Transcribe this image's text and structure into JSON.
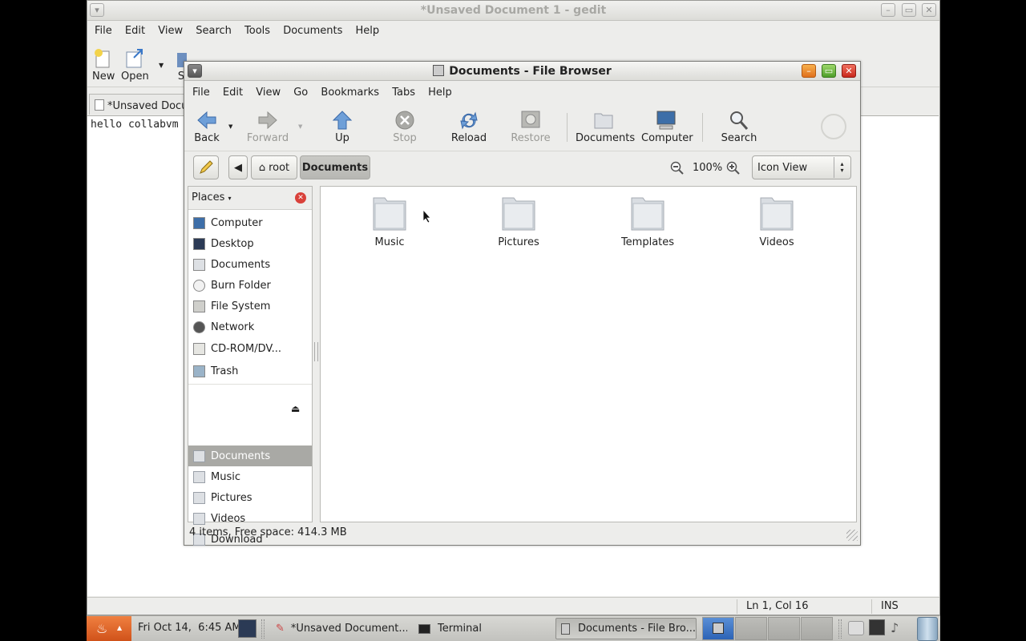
{
  "gedit": {
    "title": "*Unsaved Document 1 - gedit",
    "menu": [
      "File",
      "Edit",
      "View",
      "Search",
      "Tools",
      "Documents",
      "Help"
    ],
    "toolbar": {
      "new": "New",
      "open": "Open",
      "save_partial": "S"
    },
    "tab_label": "*Unsaved Docum",
    "editor_text": "hello collabvm",
    "status": {
      "position": "Ln 1, Col 16",
      "mode": "INS"
    }
  },
  "file_browser": {
    "title": "Documents - File Browser",
    "menu": [
      "File",
      "Edit",
      "View",
      "Go",
      "Bookmarks",
      "Tabs",
      "Help"
    ],
    "toolbar": {
      "back": "Back",
      "forward": "Forward",
      "up": "Up",
      "stop": "Stop",
      "reload": "Reload",
      "restore": "Restore",
      "documents": "Documents",
      "computer": "Computer",
      "search": "Search"
    },
    "path": [
      "root",
      "Documents"
    ],
    "zoom": "100%",
    "view_mode": "Icon View",
    "sidebar": {
      "header": "Places",
      "places": [
        {
          "label": "Computer",
          "icon": "computer-icon"
        },
        {
          "label": "Desktop",
          "icon": "desktop-icon"
        },
        {
          "label": "Documents",
          "icon": "folder-icon"
        },
        {
          "label": "Burn Folder",
          "icon": "disc-icon"
        },
        {
          "label": "File System",
          "icon": "drive-icon"
        },
        {
          "label": "Network",
          "icon": "network-icon"
        },
        {
          "label": "CD-ROM/DV...",
          "icon": "cdrom-icon"
        },
        {
          "label": "Trash",
          "icon": "trash-icon"
        }
      ],
      "bookmarks": [
        {
          "label": "Documents",
          "selected": true
        },
        {
          "label": "Music"
        },
        {
          "label": "Pictures"
        },
        {
          "label": "Videos"
        },
        {
          "label": "Download"
        }
      ]
    },
    "items": [
      "Music",
      "Pictures",
      "Templates",
      "Videos"
    ],
    "status": "4 items, Free space: 414.3 MB"
  },
  "taskbar": {
    "clock": "Fri Oct 14,  6:45 AM",
    "tasks": [
      "*Unsaved Document...",
      "Terminal",
      "Documents - File Bro..."
    ]
  },
  "colors": {
    "selection": "#a9a9a5",
    "start_button": "#e0662c",
    "pager_active": "#3a73c4",
    "folder": "#d9dde2"
  }
}
